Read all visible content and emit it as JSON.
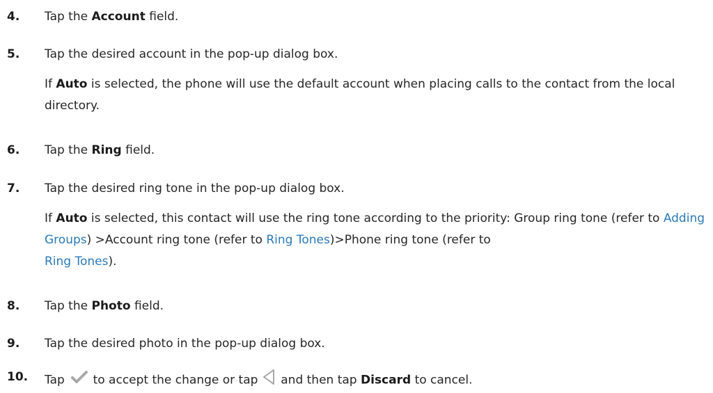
{
  "steps": [
    {
      "num": "4.",
      "pre": "Tap the ",
      "bold": "Account",
      "post": " field."
    },
    {
      "num": "5.",
      "text": "Tap the desired account in the pop-up dialog box."
    },
    {
      "num": "6.",
      "pre": "Tap the ",
      "bold": "Ring",
      "post": " field."
    },
    {
      "num": "7.",
      "text": "Tap the desired ring tone in the pop-up dialog box."
    },
    {
      "num": "8.",
      "pre": "Tap the ",
      "bold": "Photo",
      "post": " field."
    },
    {
      "num": "9.",
      "text": "Tap the desired photo in the pop-up dialog box."
    },
    {
      "num": "10.",
      "pre": "Tap ",
      "mid1": " to accept the change or tap ",
      "mid2": " and then tap ",
      "bold": "Discard",
      "post": " to cancel."
    }
  ],
  "note_account": {
    "pre": "If ",
    "bold": "Auto",
    "post": " is selected, the phone will use the default account when placing calls to the contact from the local directory."
  },
  "note_ring": {
    "pre": "If ",
    "bold": "Auto",
    "post1": " is selected, this contact will use the ring tone according to the priority: Group ring tone (refer to ",
    "link1": "Adding Groups",
    "post2": ") >Account ring tone (refer to ",
    "link2": "Ring Tones",
    "post3": ")>Phone ring tone (refer to ",
    "link3": "Ring Tones",
    "post4": ")."
  },
  "icons": {
    "accept": "checkmark-icon",
    "back": "back-triangle-icon"
  },
  "colors": {
    "link": "#2a7ab8",
    "icon": "#a8a8a8"
  }
}
